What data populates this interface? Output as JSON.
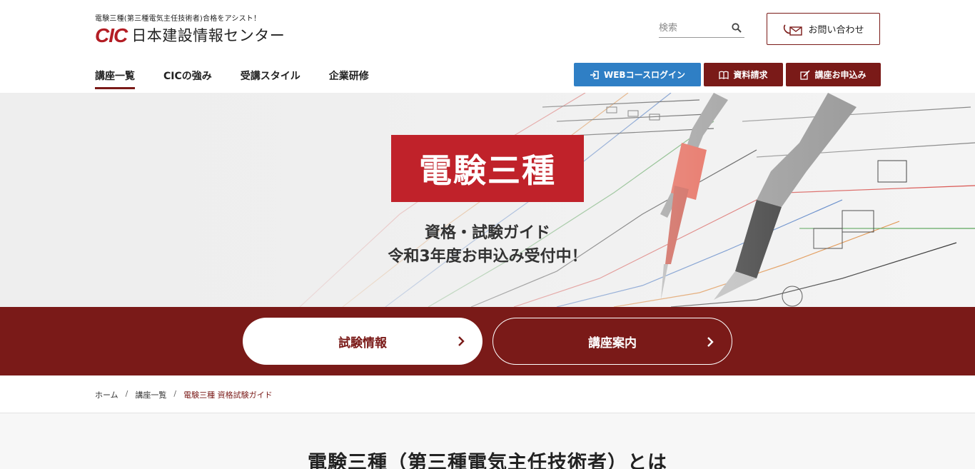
{
  "header": {
    "tagline": "電験三種(第三種電気主任技術者)合格をアシスト！",
    "logo_mark": "CIC",
    "logo_text": "日本建設情報センター",
    "search_placeholder": "検索",
    "contact_label": "お問い合わせ"
  },
  "nav": {
    "items": [
      {
        "label": "講座一覧"
      },
      {
        "label": "CICの強み"
      },
      {
        "label": "受講スタイル"
      },
      {
        "label": "企業研修"
      }
    ]
  },
  "actions": {
    "web_login": "WEBコースログイン",
    "request_docs": "資料請求",
    "apply": "講座お申込み"
  },
  "hero": {
    "badge": "電験三種",
    "line1": "資格・試験ガイド",
    "line2": "令和3年度お申込み受付中！"
  },
  "band": {
    "exam_info": "試験情報",
    "course_info": "講座案内"
  },
  "breadcrumb": {
    "home": "ホーム",
    "list": "講座一覧",
    "current": "電験三種 資格試験ガイド"
  },
  "main": {
    "heading": "電験三種（第三種電気主任技術者）とは"
  },
  "colors": {
    "brand_red": "#b31d24",
    "dark_red": "#7a1a18",
    "login_blue": "#2f7fc5"
  }
}
